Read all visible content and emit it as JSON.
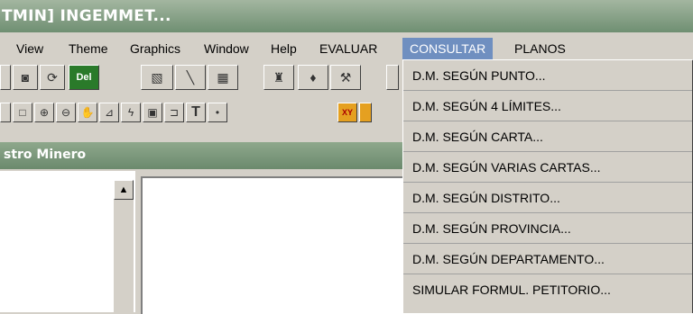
{
  "window": {
    "title": "TMIN] INGEMMET..."
  },
  "menubar": {
    "items": [
      {
        "label": "View"
      },
      {
        "label": "Theme"
      },
      {
        "label": "Graphics"
      },
      {
        "label": "Window"
      },
      {
        "label": "Help"
      },
      {
        "label": "EVALUAR"
      },
      {
        "label": "CONSULTAR"
      },
      {
        "label": "PLANOS"
      }
    ]
  },
  "toolbar": {
    "del_label": "Del",
    "text_tool": "T",
    "xy_label": "XY"
  },
  "panel": {
    "title": "stro Minero"
  },
  "dropdown": {
    "items": [
      {
        "label": "D.M. SEGÚN PUNTO..."
      },
      {
        "label": "D.M. SEGÚN 4 LÍMITES..."
      },
      {
        "label": "D.M. SEGÚN CARTA..."
      },
      {
        "label": "D.M. SEGÚN VARIAS CARTAS..."
      },
      {
        "label": "D.M. SEGÚN DISTRITO..."
      },
      {
        "label": "D.M. SEGÚN PROVINCIA..."
      },
      {
        "label": "D.M. SEGÚN DEPARTAMENTO..."
      },
      {
        "label": "SIMULAR FORMUL. PETITORIO..."
      }
    ]
  },
  "icons": [
    "camera-icon",
    "refresh-icon",
    "delete-icon",
    "edit-icon",
    "pencil-icon",
    "grid-icon",
    "binoculars-icon",
    "pin-icon",
    "tool-icon",
    "text-icon",
    "dot-icon",
    "xy-icon"
  ]
}
